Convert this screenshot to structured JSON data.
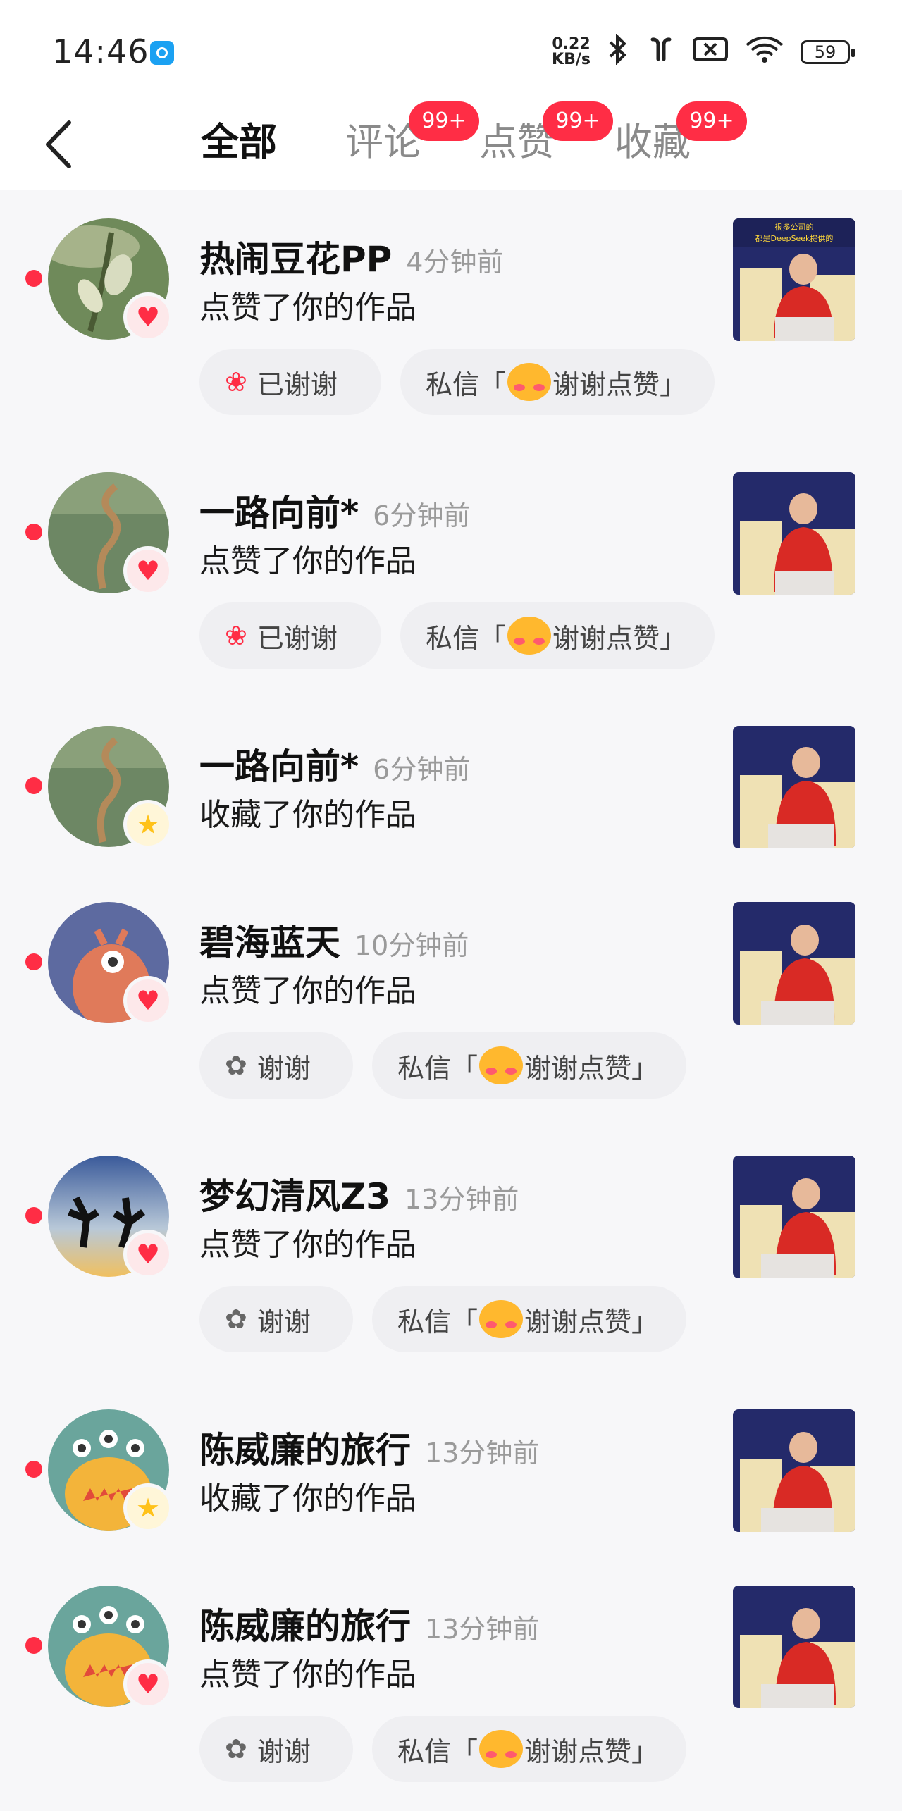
{
  "status_bar": {
    "time": "14:46",
    "net_speed_value": "0.22",
    "net_speed_unit": "KB/s",
    "battery": "59",
    "icons": [
      "bluetooth-icon",
      "earbuds-icon",
      "sim-off-icon",
      "wifi-icon"
    ]
  },
  "header": {
    "back_icon": "chevron-left-icon",
    "tabs": [
      {
        "label": "全部",
        "active": true
      },
      {
        "label": "评论",
        "badge": "99+"
      },
      {
        "label": "点赞",
        "badge": "99+"
      },
      {
        "label": "收藏",
        "badge": "99+"
      }
    ]
  },
  "colors": {
    "accent_red": "#ff2d45",
    "favorite_yellow": "#ffc21a",
    "background": "#f7f7f9"
  },
  "notifications": [
    {
      "name": "热闹豆花PP",
      "time": "4分钟前",
      "action": "点赞了你的作品",
      "type": "like",
      "thank": {
        "label": "已谢谢",
        "done": true
      },
      "dm": {
        "prefix": "私信「",
        "text": "谢谢点赞",
        "suffix": "」"
      }
    },
    {
      "name": "一路向前*",
      "time": "6分钟前",
      "action": "点赞了你的作品",
      "type": "like",
      "thank": {
        "label": "已谢谢",
        "done": true
      },
      "dm": {
        "prefix": "私信「",
        "text": "谢谢点赞",
        "suffix": "」"
      }
    },
    {
      "name": "一路向前*",
      "time": "6分钟前",
      "action": "收藏了你的作品",
      "type": "favorite"
    },
    {
      "name": "碧海蓝天",
      "time": "10分钟前",
      "action": "点赞了你的作品",
      "type": "like",
      "thank": {
        "label": "谢谢",
        "done": false
      },
      "dm": {
        "prefix": "私信「",
        "text": "谢谢点赞",
        "suffix": "」"
      }
    },
    {
      "name": "梦幻清风Z3",
      "time": "13分钟前",
      "action": "点赞了你的作品",
      "type": "like",
      "thank": {
        "label": "谢谢",
        "done": false
      },
      "dm": {
        "prefix": "私信「",
        "text": "谢谢点赞",
        "suffix": "」"
      }
    },
    {
      "name": "陈威廉的旅行",
      "time": "13分钟前",
      "action": "收藏了你的作品",
      "type": "favorite"
    },
    {
      "name": "陈威廉的旅行",
      "time": "13分钟前",
      "action": "点赞了你的作品",
      "type": "like",
      "thank": {
        "label": "谢谢",
        "done": false
      },
      "dm": {
        "prefix": "私信「",
        "text": "谢谢点赞",
        "suffix": "」"
      }
    }
  ],
  "thumbnail_caption": [
    "很多公司的",
    "都是DeepSeek提供的"
  ]
}
